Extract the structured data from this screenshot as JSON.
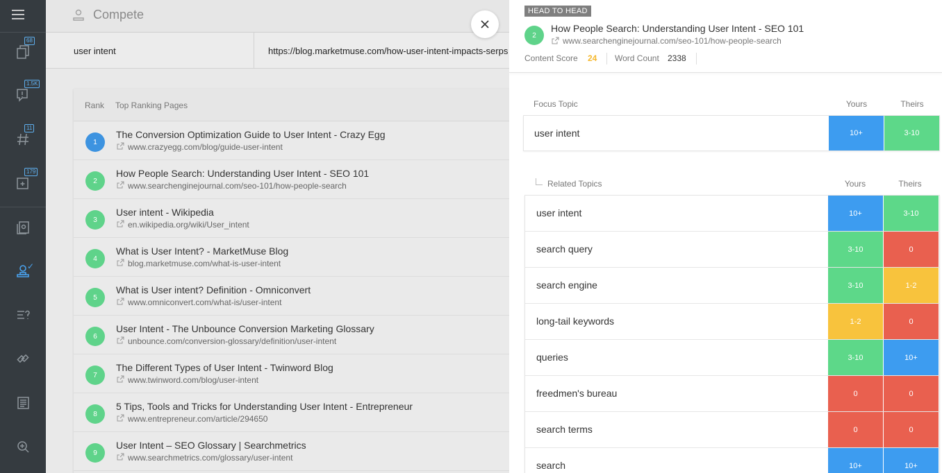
{
  "app": {
    "page_title": "Compete"
  },
  "sidebar": {
    "items": [
      {
        "icon": "documents-icon",
        "badge": "68"
      },
      {
        "icon": "comments-icon",
        "badge": "1.5K"
      },
      {
        "icon": "hashtag-icon",
        "badge": "11"
      },
      {
        "icon": "add-document-icon",
        "badge": "179"
      },
      {
        "icon": "research-icon",
        "badge": ""
      },
      {
        "icon": "compete-icon",
        "badge": ""
      },
      {
        "icon": "questions-icon",
        "badge": ""
      },
      {
        "icon": "connect-icon",
        "badge": ""
      },
      {
        "icon": "newspaper-icon",
        "badge": ""
      },
      {
        "icon": "optimize-search-icon",
        "badge": ""
      }
    ]
  },
  "search": {
    "keyword": "user intent",
    "url": "https://blog.marketmuse.com/how-user-intent-impacts-serps"
  },
  "table": {
    "rank_header": "Rank",
    "pages_header": "Top Ranking Pages",
    "rows": [
      {
        "rank": "1",
        "title": "The Conversion Optimization Guide to User Intent - Crazy Egg",
        "url": "www.crazyegg.com/blog/guide-user-intent",
        "color": "#3d93e0"
      },
      {
        "rank": "2",
        "title": "How People Search: Understanding User Intent - SEO 101",
        "url": "www.searchenginejournal.com/seo-101/how-people-search",
        "color": "#5fd38a"
      },
      {
        "rank": "3",
        "title": "User intent - Wikipedia",
        "url": "en.wikipedia.org/wiki/User_intent",
        "color": "#5fd38a"
      },
      {
        "rank": "4",
        "title": "What is User Intent? - MarketMuse Blog",
        "url": "blog.marketmuse.com/what-is-user-intent",
        "color": "#5fd38a"
      },
      {
        "rank": "5",
        "title": "What is User intent? Definition - Omniconvert",
        "url": "www.omniconvert.com/what-is/user-intent",
        "color": "#5fd38a"
      },
      {
        "rank": "6",
        "title": "User Intent - The Unbounce Conversion Marketing Glossary",
        "url": "unbounce.com/conversion-glossary/definition/user-intent",
        "color": "#5fd38a"
      },
      {
        "rank": "7",
        "title": "The Different Types of User Intent - Twinword Blog",
        "url": "www.twinword.com/blog/user-intent",
        "color": "#5fd38a"
      },
      {
        "rank": "8",
        "title": "5 Tips, Tools and Tricks for Understanding User Intent - Entrepreneur",
        "url": "www.entrepreneur.com/article/294650",
        "color": "#5fd38a"
      },
      {
        "rank": "9",
        "title": "User Intent – SEO Glossary | Searchmetrics",
        "url": "www.searchmetrics.com/glossary/user-intent",
        "color": "#5fd38a"
      }
    ]
  },
  "panel": {
    "tag": "HEAD TO HEAD",
    "rank": "2",
    "title": "How People Search: Understanding User Intent - SEO 101",
    "url": "www.searchenginejournal.com/seo-101/how-people-search",
    "content_score_label": "Content Score",
    "content_score": "24",
    "word_count_label": "Word Count",
    "word_count": "2338",
    "focus_label": "Focus Topic",
    "related_label": "Related Topics",
    "yours_label": "Yours",
    "theirs_label": "Theirs",
    "focus": {
      "name": "user intent",
      "yours": "10+",
      "theirs": "3-10",
      "yours_color": "#3d9cf0",
      "theirs_color": "#5dd889"
    },
    "related": [
      {
        "name": "user intent",
        "yours": "10+",
        "theirs": "3-10",
        "yours_color": "#3d9cf0",
        "theirs_color": "#5dd889"
      },
      {
        "name": "search query",
        "yours": "3-10",
        "theirs": "0",
        "yours_color": "#5dd889",
        "theirs_color": "#e9604f"
      },
      {
        "name": "search engine",
        "yours": "3-10",
        "theirs": "1-2",
        "yours_color": "#5dd889",
        "theirs_color": "#f8c33d"
      },
      {
        "name": "long-tail keywords",
        "yours": "1-2",
        "theirs": "0",
        "yours_color": "#f8c33d",
        "theirs_color": "#e9604f"
      },
      {
        "name": "queries",
        "yours": "3-10",
        "theirs": "10+",
        "yours_color": "#5dd889",
        "theirs_color": "#3d9cf0"
      },
      {
        "name": "freedmen's bureau",
        "yours": "0",
        "theirs": "0",
        "yours_color": "#e9604f",
        "theirs_color": "#e9604f"
      },
      {
        "name": "search terms",
        "yours": "0",
        "theirs": "0",
        "yours_color": "#e9604f",
        "theirs_color": "#e9604f"
      },
      {
        "name": "search",
        "yours": "10+",
        "theirs": "10+",
        "yours_color": "#3d9cf0",
        "theirs_color": "#3d9cf0"
      }
    ]
  },
  "colors": {
    "score": "#f5b82e",
    "sidebar": "#353b40",
    "accent": "#3d9cf0"
  }
}
